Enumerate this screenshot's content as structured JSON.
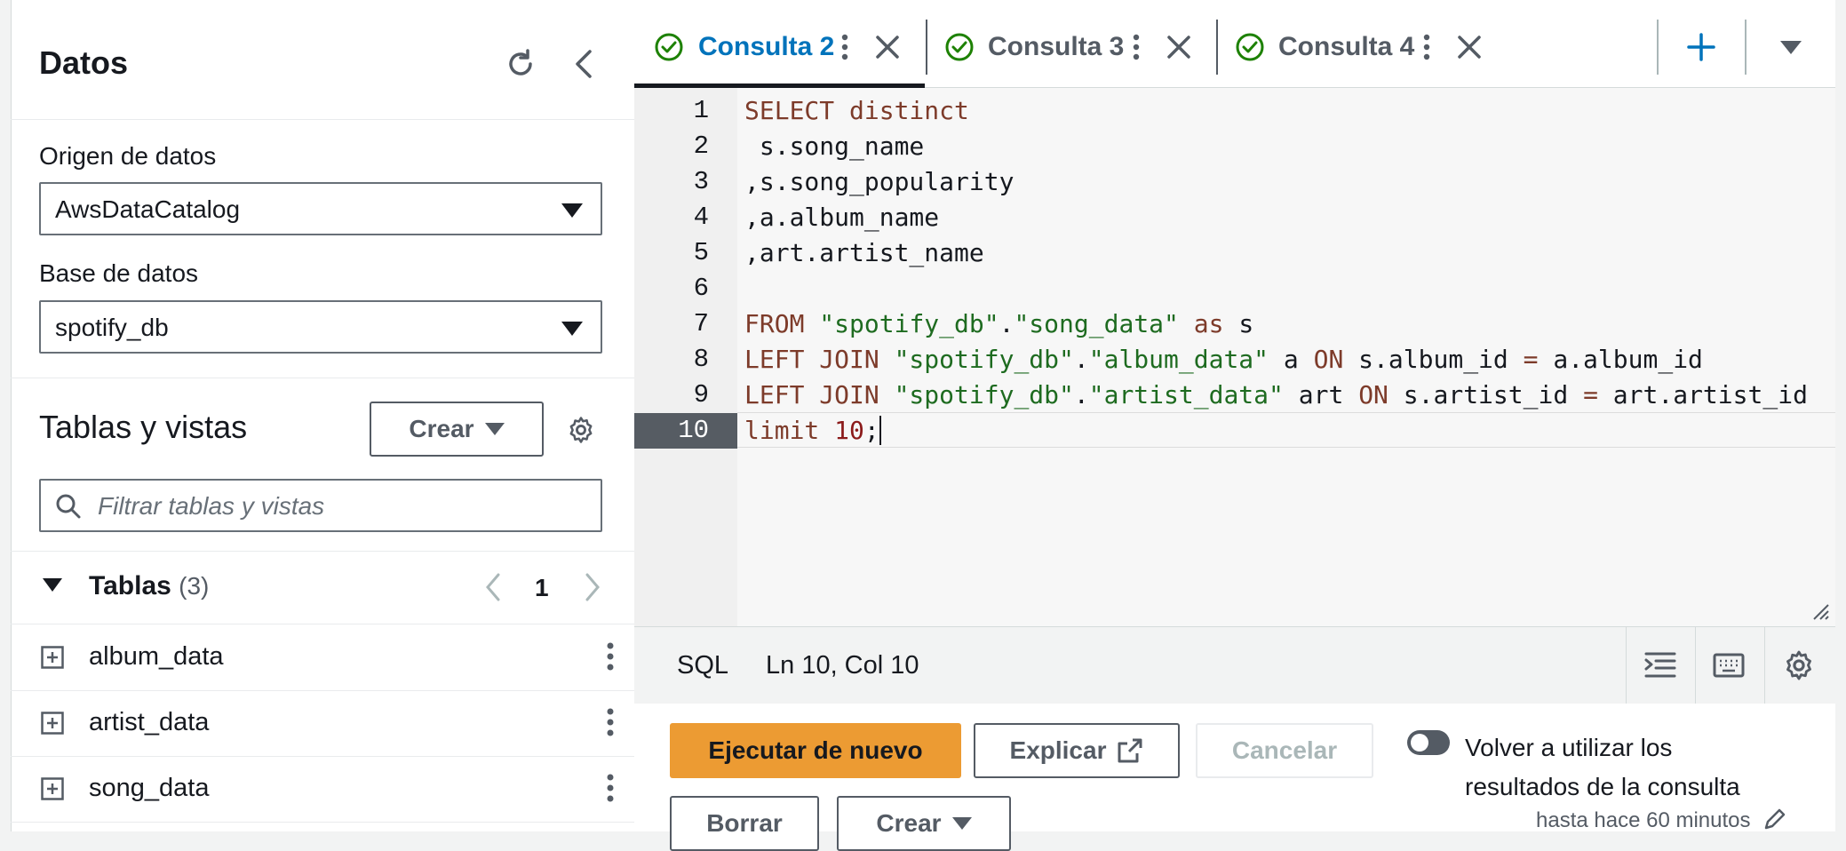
{
  "panel": {
    "title": "Datos",
    "source_label": "Origen de datos",
    "source_value": "AwsDataCatalog",
    "db_label": "Base de datos",
    "db_value": "spotify_db",
    "tables_title": "Tablas y vistas",
    "create_label": "Crear",
    "filter_placeholder": "Filtrar tablas y vistas",
    "tables_section": "Tablas",
    "tables_count": "(3)",
    "page": "1",
    "tables": [
      "album_data",
      "artist_data",
      "song_data"
    ]
  },
  "tabs": [
    "Consulta 2",
    "Consulta 3",
    "Consulta 4"
  ],
  "editor": {
    "line_numbers": [
      "1",
      "2",
      "3",
      "4",
      "5",
      "6",
      "7",
      "8",
      "9",
      "10"
    ]
  },
  "status": {
    "language": "SQL",
    "position": "Ln 10, Col 10"
  },
  "actions": {
    "run_label": "Ejecutar de nuevo",
    "explain_label": "Explicar",
    "cancel_label": "Cancelar",
    "reuse_label_1": "Volver a utilizar los",
    "reuse_label_2": "resultados de la consulta",
    "reuse_sub": "hasta hace 60 minutos",
    "clear_label": "Borrar",
    "create_label": "Crear"
  },
  "colors": {
    "accent": "#0073bb",
    "primary_button": "#ec9b33",
    "success": "#1d8102"
  }
}
